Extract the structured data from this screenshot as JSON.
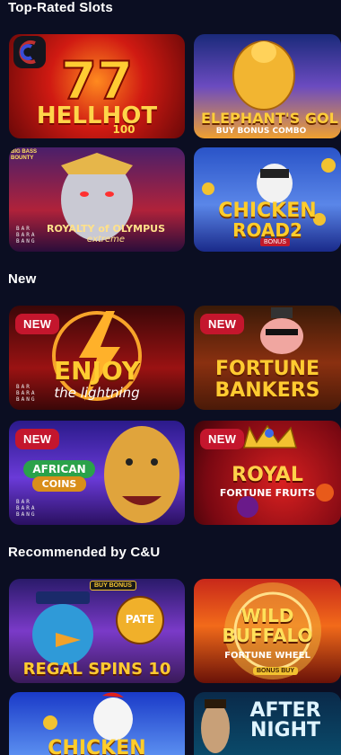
{
  "sections": {
    "top_rated": "Top-Rated Slots",
    "new": "New",
    "recommended": "Recommended by C&U"
  },
  "badges": {
    "new": "NEW"
  },
  "games": {
    "hellhot": {
      "title": "HELLHOT",
      "sub": "100"
    },
    "elephants": {
      "title": "ELEPHANT'S GOL",
      "sub": "BUY BONUS COMBO"
    },
    "olympus": {
      "title": "ROYALTY of OLYMPUS",
      "sub": "extreme",
      "provider": "BAR\nBARA\nBANG",
      "corner": "BIG BASS BOUNTY"
    },
    "chicken2": {
      "title": "CHICKEN",
      "sub": "ROAD2",
      "tag": "BONUS"
    },
    "enjoy": {
      "title": "ENJOY",
      "sub": "the lightning",
      "provider": "BAR\nBARA\nBANG"
    },
    "fortune_bankers": {
      "title": "FORTUNE",
      "sub": "BANKERS"
    },
    "african": {
      "title": "AFRICAN",
      "sub": "COINS",
      "provider": "BAR\nBARA\nBANG"
    },
    "royal": {
      "title": "ROYAL",
      "sub": "FORTUNE FRUITS"
    },
    "regal": {
      "title": "REGAL SPINS 10",
      "sub": "PATE",
      "tag": "BUY BONUS"
    },
    "buffalo": {
      "title": "WILD BUFFALO",
      "sub": "FORTUNE WHEEL",
      "tag": "BONUS BUY"
    },
    "chicken": {
      "title": "CHICKEN"
    },
    "afternight": {
      "title": "AFTER NIGHT"
    }
  },
  "colors": {
    "background": "#0b0e22",
    "badge": "#c4162d"
  }
}
